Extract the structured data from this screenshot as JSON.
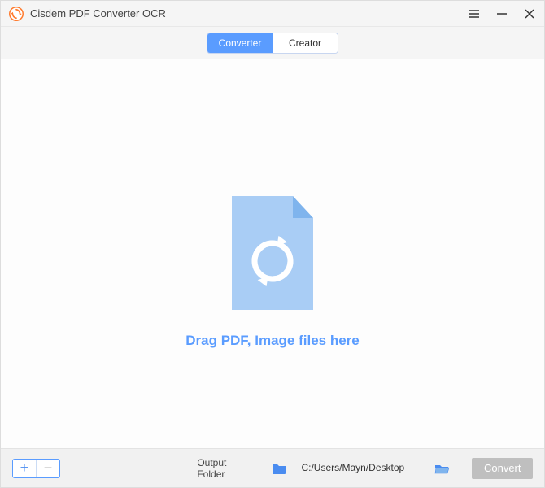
{
  "app": {
    "title": "Cisdem PDF Converter OCR"
  },
  "tabs": {
    "converter": "Converter",
    "creator": "Creator",
    "active": "converter"
  },
  "main": {
    "dropText": "Drag PDF, Image files here"
  },
  "footer": {
    "outputLabel": "Output Folder",
    "outputPath": "C:/Users/Mayn/Desktop",
    "convertLabel": "Convert"
  }
}
